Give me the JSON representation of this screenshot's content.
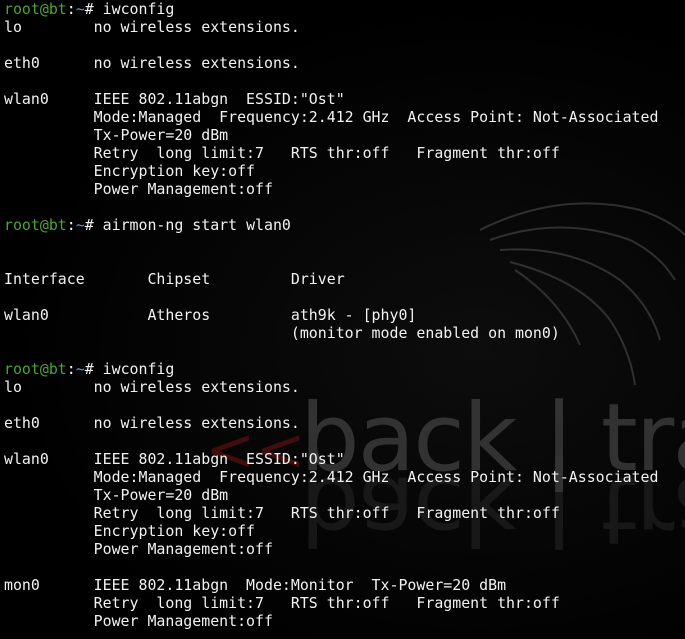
{
  "wallpaper": {
    "brand_text": "back | track",
    "decor_icon": "dragon-wing-icon"
  },
  "prompt": {
    "user_host": "root@bt",
    "separator": ":",
    "path": "~",
    "symbol": "#"
  },
  "lines": [
    {
      "type": "prompt",
      "command": " iwconfig"
    },
    {
      "type": "text",
      "text": "lo        no wireless extensions."
    },
    {
      "type": "text",
      "text": ""
    },
    {
      "type": "text",
      "text": "eth0      no wireless extensions."
    },
    {
      "type": "text",
      "text": ""
    },
    {
      "type": "text",
      "text": "wlan0     IEEE 802.11abgn  ESSID:\"Ost\""
    },
    {
      "type": "text",
      "text": "          Mode:Managed  Frequency:2.412 GHz  Access Point: Not-Associated"
    },
    {
      "type": "text",
      "text": "          Tx-Power=20 dBm"
    },
    {
      "type": "text",
      "text": "          Retry  long limit:7   RTS thr:off   Fragment thr:off"
    },
    {
      "type": "text",
      "text": "          Encryption key:off"
    },
    {
      "type": "text",
      "text": "          Power Management:off"
    },
    {
      "type": "text",
      "text": ""
    },
    {
      "type": "prompt",
      "command": " airmon-ng start wlan0"
    },
    {
      "type": "text",
      "text": ""
    },
    {
      "type": "text",
      "text": ""
    },
    {
      "type": "text",
      "text": "Interface       Chipset         Driver"
    },
    {
      "type": "text",
      "text": ""
    },
    {
      "type": "text",
      "text": "wlan0           Atheros         ath9k - [phy0]"
    },
    {
      "type": "text",
      "text": "                                (monitor mode enabled on mon0)"
    },
    {
      "type": "text",
      "text": ""
    },
    {
      "type": "prompt",
      "command": " iwconfig"
    },
    {
      "type": "text",
      "text": "lo        no wireless extensions."
    },
    {
      "type": "text",
      "text": ""
    },
    {
      "type": "text",
      "text": "eth0      no wireless extensions."
    },
    {
      "type": "text",
      "text": ""
    },
    {
      "type": "text",
      "text": "wlan0     IEEE 802.11abgn  ESSID:\"Ost\""
    },
    {
      "type": "text",
      "text": "          Mode:Managed  Frequency:2.412 GHz  Access Point: Not-Associated"
    },
    {
      "type": "text",
      "text": "          Tx-Power=20 dBm"
    },
    {
      "type": "text",
      "text": "          Retry  long limit:7   RTS thr:off   Fragment thr:off"
    },
    {
      "type": "text",
      "text": "          Encryption key:off"
    },
    {
      "type": "text",
      "text": "          Power Management:off"
    },
    {
      "type": "text",
      "text": ""
    },
    {
      "type": "text",
      "text": "mon0      IEEE 802.11abgn  Mode:Monitor  Tx-Power=20 dBm"
    },
    {
      "type": "text",
      "text": "          Retry  long limit:7   RTS thr:off   Fragment thr:off"
    },
    {
      "type": "text",
      "text": "          Power Management:off"
    }
  ]
}
